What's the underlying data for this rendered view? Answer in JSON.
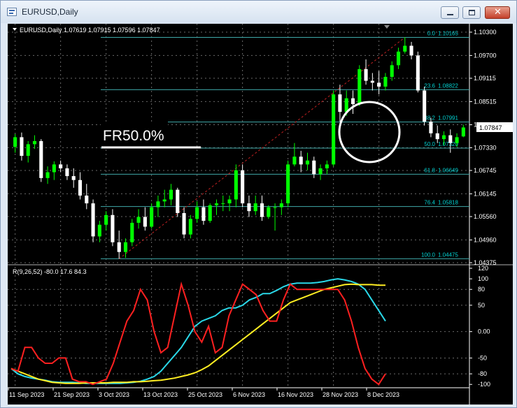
{
  "window": {
    "title": "EURUSD,Daily"
  },
  "colors": {
    "background": "#000000",
    "bull_candle": "#00ff00",
    "bear_candle": "#ffffff",
    "fib_line": "#3fa9a9",
    "fib_text": "#00d0d0",
    "red_line": "#ff2020",
    "aqua_line": "#2ad8e8",
    "yellow_line": "#ffee22",
    "trend_line": "#c02020",
    "axis_text": "#ffffff"
  },
  "main": {
    "info": "EURUSD,Daily  1.07619 1.07915 1.07596 1.07847",
    "current_price": "1.07847",
    "annotation": "FR50.0%",
    "price_ticks": [
      "1.10300",
      "1.09700",
      "1.09115",
      "1.08515",
      "1.07920",
      "1.07330",
      "1.06745",
      "1.06145",
      "1.05560",
      "1.04960",
      "1.04375"
    ],
    "fib_levels": [
      {
        "ratio": "0.0",
        "price": "1.10165"
      },
      {
        "ratio": "23.6",
        "price": "1.08822"
      },
      {
        "ratio": "38.2",
        "price": "1.07991"
      },
      {
        "ratio": "50.0",
        "price": "1.07320"
      },
      {
        "ratio": "61.8",
        "price": "1.06649"
      },
      {
        "ratio": "76.4",
        "price": "1.05818"
      },
      {
        "ratio": "100.0",
        "price": "1.04475"
      }
    ]
  },
  "indicator": {
    "label": "R(9,26,52) -80.0 17.6 84.3",
    "ticks": [
      "120",
      "100",
      "80",
      "50",
      "0.00",
      "-50",
      "-80",
      "-100"
    ]
  },
  "chart_data": {
    "type": "line",
    "price_range": [
      1.04375,
      1.103
    ],
    "indicator_range": [
      -105,
      120
    ],
    "x_labels": [
      "11 Sep 2023",
      "21 Sep 2023",
      "3 Oct 2023",
      "13 Oct 2023",
      "25 Oct 2023",
      "6 Nov 2023",
      "16 Nov 2023",
      "28 Nov 2023",
      "8 Dec 2023"
    ],
    "ohlc": [
      [
        1.0735,
        1.0768,
        1.072,
        1.076
      ],
      [
        1.076,
        1.0772,
        1.07,
        1.0712
      ],
      [
        1.0712,
        1.075,
        1.0695,
        1.0742
      ],
      [
        1.0742,
        1.0765,
        1.073,
        1.075
      ],
      [
        1.075,
        1.0755,
        1.0645,
        1.0655
      ],
      [
        1.0655,
        1.0685,
        1.064,
        1.067
      ],
      [
        1.067,
        1.0698,
        1.065,
        1.069
      ],
      [
        1.069,
        1.07,
        1.067,
        1.068
      ],
      [
        1.068,
        1.069,
        1.065,
        1.066
      ],
      [
        1.066,
        1.068,
        1.063,
        1.065
      ],
      [
        1.065,
        1.067,
        1.06,
        1.061
      ],
      [
        1.061,
        1.064,
        1.0575,
        1.059
      ],
      [
        1.059,
        1.06,
        1.049,
        1.0505
      ],
      [
        1.0505,
        1.0545,
        1.049,
        1.0535
      ],
      [
        1.0535,
        1.057,
        1.052,
        1.056
      ],
      [
        1.056,
        1.0575,
        1.048,
        1.049
      ],
      [
        1.049,
        1.052,
        1.0448,
        1.0465
      ],
      [
        1.0465,
        1.05,
        1.045,
        1.049
      ],
      [
        1.049,
        1.055,
        1.048,
        1.054
      ],
      [
        1.054,
        1.0575,
        1.0525,
        1.0555
      ],
      [
        1.0555,
        1.058,
        1.052,
        1.053
      ],
      [
        1.053,
        1.059,
        1.0525,
        1.058
      ],
      [
        1.058,
        1.061,
        1.0555,
        1.0595
      ],
      [
        1.0595,
        1.0625,
        1.058,
        1.06
      ],
      [
        1.06,
        1.064,
        1.0585,
        1.0625
      ],
      [
        1.0625,
        1.063,
        1.0555,
        1.0565
      ],
      [
        1.0565,
        1.058,
        1.05,
        1.051
      ],
      [
        1.051,
        1.056,
        1.05,
        1.055
      ],
      [
        1.055,
        1.0595,
        1.054,
        1.058
      ],
      [
        1.058,
        1.06,
        1.0535,
        1.0545
      ],
      [
        1.0545,
        1.059,
        1.054,
        1.0585
      ],
      [
        1.0585,
        1.06,
        1.056,
        1.059
      ],
      [
        1.059,
        1.061,
        1.057,
        1.059
      ],
      [
        1.059,
        1.061,
        1.057,
        1.06
      ],
      [
        1.06,
        1.069,
        1.058,
        1.0675
      ],
      [
        1.0675,
        1.069,
        1.058,
        1.059
      ],
      [
        1.059,
        1.061,
        1.0555,
        1.057
      ],
      [
        1.057,
        1.061,
        1.056,
        1.059
      ],
      [
        1.059,
        1.061,
        1.0545,
        1.0555
      ],
      [
        1.0555,
        1.0585,
        1.055,
        1.058
      ],
      [
        1.058,
        1.059,
        1.052,
        1.058
      ],
      [
        1.058,
        1.06,
        1.056,
        1.059
      ],
      [
        1.059,
        1.07,
        1.058,
        1.069
      ],
      [
        1.069,
        1.0745,
        1.0685,
        1.071
      ],
      [
        1.071,
        1.0725,
        1.067,
        1.069
      ],
      [
        1.069,
        1.072,
        1.0675,
        1.07
      ],
      [
        1.07,
        1.071,
        1.0655,
        1.0665
      ],
      [
        1.0665,
        1.069,
        1.065,
        1.068
      ],
      [
        1.068,
        1.07,
        1.0665,
        1.069
      ],
      [
        1.069,
        1.088,
        1.0685,
        1.087
      ],
      [
        1.087,
        1.0895,
        1.08,
        1.0825
      ],
      [
        1.0825,
        1.088,
        1.0815,
        1.086
      ],
      [
        1.086,
        1.088,
        1.082,
        1.0845
      ],
      [
        1.0845,
        1.0945,
        1.084,
        1.0935
      ],
      [
        1.0935,
        1.096,
        1.0895,
        1.0905
      ],
      [
        1.0905,
        1.0925,
        1.088,
        1.09
      ],
      [
        1.09,
        1.093,
        1.087,
        1.089
      ],
      [
        1.089,
        1.0925,
        1.088,
        1.0915
      ],
      [
        1.0915,
        1.0955,
        1.0905,
        1.0945
      ],
      [
        1.0945,
        1.099,
        1.0935,
        1.098
      ],
      [
        1.098,
        1.1017,
        1.0975,
        1.0995
      ],
      [
        1.0995,
        1.1005,
        1.096,
        1.097
      ],
      [
        1.097,
        1.098,
        1.0875,
        1.088
      ],
      [
        1.088,
        1.089,
        1.079,
        1.08
      ],
      [
        1.08,
        1.081,
        1.076,
        1.077
      ],
      [
        1.077,
        1.079,
        1.0745,
        1.0755
      ],
      [
        1.0755,
        1.0775,
        1.074,
        1.0765
      ],
      [
        1.0765,
        1.078,
        1.072,
        1.0745
      ],
      [
        1.0745,
        1.077,
        1.0735,
        1.076
      ],
      [
        1.0762,
        1.0792,
        1.076,
        1.0785
      ]
    ],
    "series": [
      {
        "values": [
          -70,
          -80,
          -85,
          -88,
          -90,
          -92,
          -95,
          -96,
          -96,
          -96,
          -97,
          -98,
          -98,
          -98,
          -98,
          -98,
          -98,
          -97,
          -96,
          -94,
          -90,
          -85,
          -75,
          -60,
          -45,
          -30,
          -10,
          10,
          20,
          25,
          30,
          40,
          45,
          45,
          50,
          60,
          65,
          72,
          72,
          78,
          85,
          90,
          92,
          92,
          92,
          93,
          95,
          98,
          100,
          98,
          95,
          90,
          80,
          60,
          40,
          20
        ]
      },
      {
        "values": [
          -70,
          -75,
          -80,
          -85,
          -90,
          -93,
          -96,
          -97,
          -98,
          -98,
          -98,
          -97,
          -97,
          -97,
          -97,
          -96,
          -96,
          -96,
          -95,
          -95,
          -94,
          -93,
          -92,
          -90,
          -88,
          -85,
          -82,
          -78,
          -72,
          -65,
          -55,
          -45,
          -35,
          -25,
          -15,
          -5,
          5,
          15,
          25,
          35,
          45,
          55,
          60,
          65,
          70,
          75,
          80,
          83,
          86,
          89,
          90,
          89,
          89,
          89,
          88,
          88
        ]
      },
      {
        "values": [
          -70,
          -75,
          -30,
          -30,
          -50,
          -60,
          -60,
          -50,
          -50,
          -90,
          -95,
          -95,
          -100,
          -95,
          -90,
          -60,
          -20,
          20,
          40,
          80,
          60,
          0,
          -40,
          -30,
          30,
          90,
          50,
          0,
          -20,
          10,
          -40,
          -30,
          30,
          60,
          90,
          80,
          70,
          40,
          20,
          20,
          60,
          90,
          80,
          80,
          80,
          80,
          80,
          80,
          80,
          60,
          20,
          -30,
          -70,
          -90,
          -100,
          -80
        ]
      }
    ]
  }
}
